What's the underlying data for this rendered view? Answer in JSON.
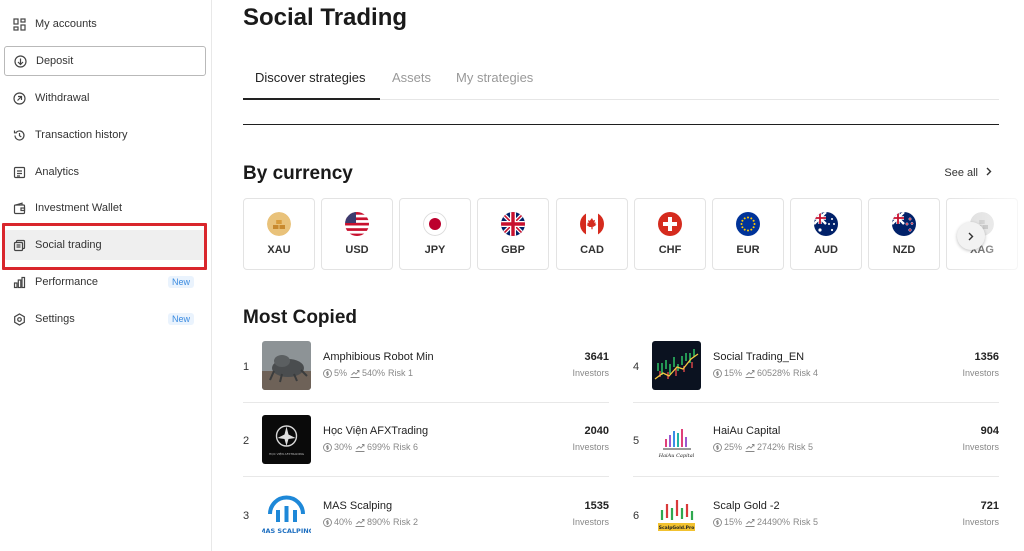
{
  "sidebar": {
    "items": [
      {
        "label": "My accounts"
      },
      {
        "label": "Deposit"
      },
      {
        "label": "Withdrawal"
      },
      {
        "label": "Transaction history"
      },
      {
        "label": "Analytics"
      },
      {
        "label": "Investment Wallet"
      },
      {
        "label": "Social trading"
      },
      {
        "label": "Performance",
        "badge": "New"
      },
      {
        "label": "Settings",
        "badge": "New"
      }
    ]
  },
  "page": {
    "title": "Social Trading"
  },
  "tabs": [
    {
      "label": "Discover strategies",
      "active": true
    },
    {
      "label": "Assets"
    },
    {
      "label": "My strategies"
    }
  ],
  "by_currency": {
    "title": "By currency",
    "see_all": "See all",
    "currencies": [
      "XAU",
      "USD",
      "JPY",
      "GBP",
      "CAD",
      "CHF",
      "EUR",
      "AUD",
      "NZD",
      "XAG"
    ]
  },
  "most_copied": {
    "title": "Most Copied",
    "strategies": [
      {
        "rank": "1",
        "name": "Amphibious Robot Min",
        "return": "5%",
        "growth": "540%",
        "risk": "Risk 1",
        "investors": "3641",
        "investors_label": "Investors"
      },
      {
        "rank": "4",
        "name": "Social Trading_EN",
        "return": "15%",
        "growth": "60528%",
        "risk": "Risk 4",
        "investors": "1356",
        "investors_label": "Investors"
      },
      {
        "rank": "2",
        "name": "Học Viện AFXTrading",
        "return": "30%",
        "growth": "699%",
        "risk": "Risk 6",
        "investors": "2040",
        "investors_label": "Investors"
      },
      {
        "rank": "5",
        "name": "HaiAu Capital",
        "return": "25%",
        "growth": "2742%",
        "risk": "Risk 5",
        "investors": "904",
        "investors_label": "Investors"
      },
      {
        "rank": "3",
        "name": "MAS Scalping",
        "return": "40%",
        "growth": "890%",
        "risk": "Risk 2",
        "investors": "1535",
        "investors_label": "Investors"
      },
      {
        "rank": "6",
        "name": "Scalp Gold -2",
        "return": "15%",
        "growth": "24490%",
        "risk": "Risk 5",
        "investors": "721",
        "investors_label": "Investors"
      }
    ]
  },
  "thumb_texts": {
    "afx": "HỌC VIỆN AFXTRADING",
    "haiau": "HaiAu Capital",
    "mas": "MAS SCALPING",
    "scalp": "ScalpGold.Pro"
  },
  "colors": {
    "highlight": "#d9262c",
    "badge": "#3b8be0",
    "active_tab": "#222222"
  }
}
